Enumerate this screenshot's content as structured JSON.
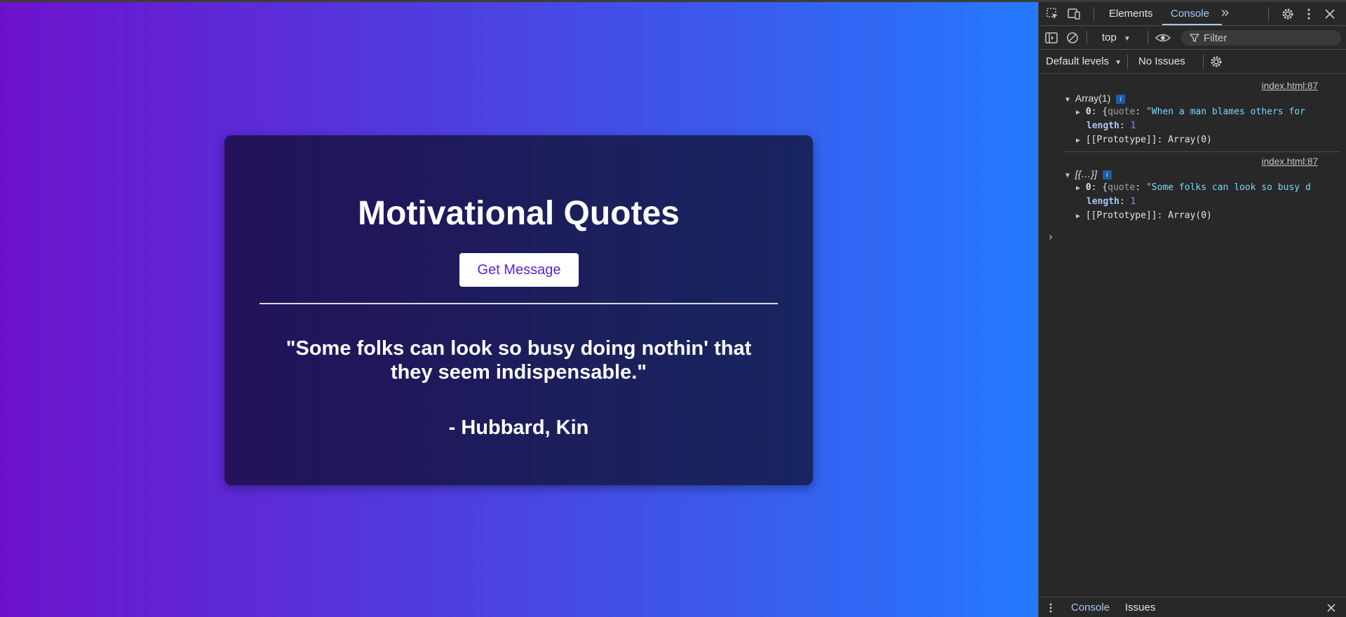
{
  "page": {
    "card": {
      "title": "Motivational Quotes",
      "button_label": "Get Message",
      "quote": "\"Some folks can look so busy doing nothin' that they seem indispensable.\"",
      "author": "- Hubbard, Kin"
    }
  },
  "devtools": {
    "tabs": [
      "Elements",
      "Console"
    ],
    "active_tab": "Console",
    "context": "top",
    "filter_placeholder": "Filter",
    "levels": "Default levels",
    "issues": "No Issues",
    "entries": [
      {
        "source": "index.html:87",
        "summary": "Array(1)",
        "item0_prefix": "0: {quote: ",
        "item0_key": "0",
        "item0_str": "\"When a man blames others for",
        "length_key": "length",
        "length_val": "1",
        "proto": "[[Prototype]]: Array(0)"
      },
      {
        "source": "index.html:87",
        "summary": "[{…}]",
        "item0_key": "0",
        "item0_str": "\"Some folks can look so busy d",
        "length_key": "length",
        "length_val": "1",
        "proto": "[[Prototype]]: Array(0)"
      }
    ],
    "drawer_tabs": [
      "Console",
      "Issues"
    ],
    "colors": {
      "accent": "#a8c7fa",
      "panel_bg": "#282828"
    }
  }
}
